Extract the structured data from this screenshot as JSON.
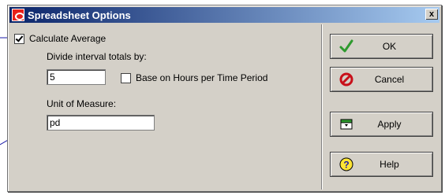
{
  "window": {
    "title": "Spreadsheet Options",
    "close_glyph": "x"
  },
  "form": {
    "calculate_average_label": "Calculate Average",
    "calculate_average_checked": true,
    "divide_interval_label": "Divide interval totals by:",
    "divide_interval_value": "5",
    "base_on_hours_label": "Base on Hours per Time Period",
    "base_on_hours_checked": false,
    "unit_label": "Unit of Measure:",
    "unit_value": "pd"
  },
  "buttons": {
    "ok_label": "OK",
    "cancel_label": "Cancel",
    "apply_label": "Apply",
    "help_label": "Help"
  },
  "icons": {
    "ok": "checkmark-icon",
    "cancel": "no-entry-icon",
    "apply": "apply-table-icon",
    "help": "help-question-icon"
  },
  "colors": {
    "titlebar_start": "#0a246a",
    "titlebar_end": "#a6caf0",
    "dialog_face": "#d4d0c8",
    "callout_line": "#1a1aa8"
  }
}
